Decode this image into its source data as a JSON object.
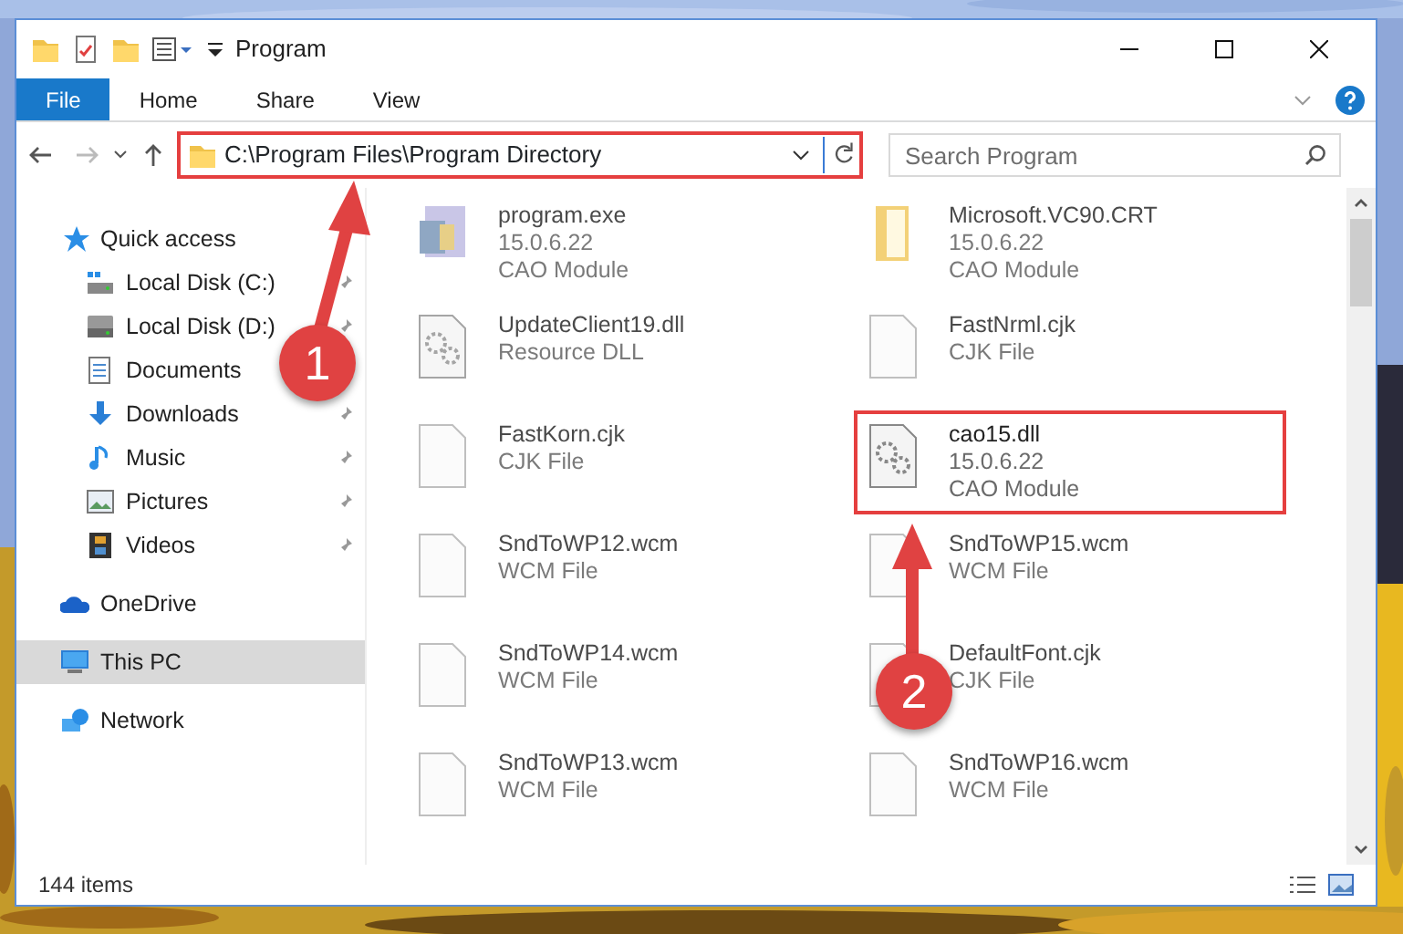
{
  "window": {
    "title": "Program"
  },
  "ribbon_tabs": [
    {
      "label": "File",
      "selected": true
    },
    {
      "label": "Home",
      "selected": false
    },
    {
      "label": "Share",
      "selected": false
    },
    {
      "label": "View",
      "selected": false
    }
  ],
  "address_bar": {
    "path": "C:\\Program Files\\Program Directory",
    "highlighted": true
  },
  "search": {
    "placeholder": "Search Program"
  },
  "sidebar": {
    "items": [
      {
        "label": "Quick access",
        "selected": false,
        "children": [
          {
            "label": "Local Disk (C:)",
            "pinned": true,
            "selected": false
          },
          {
            "label": "Local Disk (D:)",
            "pinned": true,
            "selected": false
          },
          {
            "label": "Documents",
            "pinned": false,
            "selected": false
          },
          {
            "label": "Downloads",
            "pinned": true,
            "selected": false
          },
          {
            "label": "Music",
            "pinned": true,
            "selected": false
          },
          {
            "label": "Pictures",
            "pinned": true,
            "selected": false
          },
          {
            "label": "Videos",
            "pinned": true,
            "selected": false
          }
        ]
      },
      {
        "label": "OneDrive",
        "selected": false
      },
      {
        "label": "This PC",
        "selected": true
      },
      {
        "label": "Network",
        "selected": false
      }
    ]
  },
  "files": [
    {
      "name": "program.exe",
      "version": "15.0.6.22",
      "type": "CAO Module",
      "kind": "exe",
      "blurred": true,
      "highlighted": false
    },
    {
      "name": "Microsoft.VC90.CRT",
      "version": "15.0.6.22",
      "type": "CAO Module",
      "kind": "folder",
      "blurred": true,
      "highlighted": false
    },
    {
      "name": "UpdateClient19.dll",
      "type": "Resource DLL",
      "kind": "dll",
      "blurred": true,
      "highlighted": false
    },
    {
      "name": "FastNrml.cjk",
      "type": "CJK File",
      "kind": "blank",
      "blurred": true,
      "highlighted": false
    },
    {
      "name": "FastKorn.cjk",
      "type": "CJK File",
      "kind": "blank",
      "blurred": true,
      "highlighted": false
    },
    {
      "name": "cao15.dll",
      "version": "15.0.6.22",
      "type": "CAO Module",
      "kind": "dll",
      "blurred": false,
      "highlighted": true
    },
    {
      "name": "SndToWP12.wcm",
      "type": "WCM File",
      "kind": "blank",
      "blurred": true,
      "highlighted": false
    },
    {
      "name": "SndToWP15.wcm",
      "type": "WCM File",
      "kind": "blank",
      "blurred": true,
      "highlighted": false
    },
    {
      "name": "SndToWP14.wcm",
      "type": "WCM File",
      "kind": "blank",
      "blurred": true,
      "highlighted": false
    },
    {
      "name": "DefaultFont.cjk",
      "type": "CJK File",
      "kind": "blank",
      "blurred": true,
      "highlighted": false
    },
    {
      "name": "SndToWP13.wcm",
      "type": "WCM File",
      "kind": "blank",
      "blurred": true,
      "highlighted": false
    },
    {
      "name": "SndToWP16.wcm",
      "type": "WCM File",
      "kind": "blank",
      "blurred": true,
      "highlighted": false
    }
  ],
  "status_bar": {
    "item_count": "144 items"
  },
  "annotations": [
    {
      "label": "1"
    },
    {
      "label": "2"
    }
  ]
}
